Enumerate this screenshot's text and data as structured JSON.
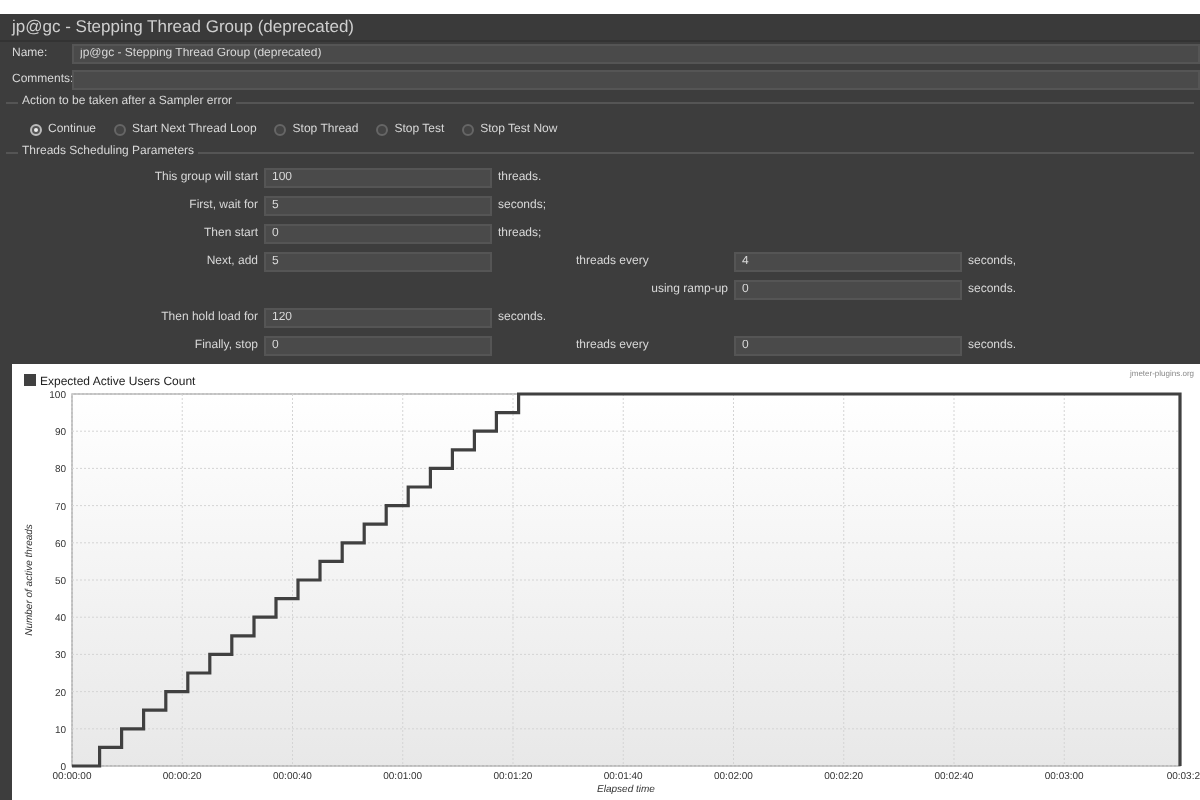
{
  "window": {
    "title": "jp@gc - Stepping Thread Group (deprecated)"
  },
  "name": {
    "label": "Name:",
    "value": "jp@gc - Stepping Thread Group (deprecated)"
  },
  "comments": {
    "label": "Comments:"
  },
  "sampler_error": {
    "title": "Action to be taken after a Sampler error",
    "options": [
      {
        "label": "Continue",
        "selected": true
      },
      {
        "label": "Start Next Thread Loop",
        "selected": false
      },
      {
        "label": "Stop Thread",
        "selected": false
      },
      {
        "label": "Stop Test",
        "selected": false
      },
      {
        "label": "Stop Test Now",
        "selected": false
      }
    ]
  },
  "scheduling": {
    "title": "Threads Scheduling Parameters",
    "rows": [
      {
        "kind": "main",
        "label": "This group will start",
        "value": "100",
        "unit": "threads."
      },
      {
        "kind": "main",
        "label": "First, wait for",
        "value": "5",
        "unit": "seconds;"
      },
      {
        "kind": "main",
        "label": "Then start",
        "value": "0",
        "unit": "threads;"
      },
      {
        "kind": "main",
        "label": "Next, add",
        "value": "5",
        "extra": {
          "label": "threads every",
          "value": "4",
          "unit": "seconds,"
        }
      },
      {
        "kind": "secondary",
        "extra": {
          "label": "using ramp-up",
          "value": "0",
          "unit": "seconds."
        }
      },
      {
        "kind": "main",
        "label": "Then hold load for",
        "value": "120",
        "unit": "seconds."
      },
      {
        "kind": "main",
        "label": "Finally, stop",
        "value": "0",
        "extra": {
          "label": "threads every",
          "value": "0",
          "unit": "seconds."
        }
      }
    ]
  },
  "chart": {
    "credit": "jmeter-plugins.org",
    "chart_data": {
      "type": "line",
      "xlabel": "Elapsed time",
      "ylabel": "Number of active threads",
      "x": [
        0,
        5,
        5,
        9,
        9,
        13,
        13,
        17,
        17,
        21,
        21,
        25,
        25,
        29,
        29,
        33,
        33,
        37,
        37,
        41,
        41,
        45,
        45,
        49,
        49,
        53,
        53,
        57,
        57,
        61,
        61,
        65,
        65,
        69,
        69,
        73,
        73,
        77,
        77,
        81,
        81,
        201,
        201
      ],
      "series": [
        {
          "name": "Expected Active Users Count",
          "color": "#404040",
          "values": [
            0,
            0,
            5,
            5,
            10,
            10,
            15,
            15,
            20,
            20,
            25,
            25,
            30,
            30,
            35,
            35,
            40,
            40,
            45,
            45,
            50,
            50,
            55,
            55,
            60,
            60,
            65,
            65,
            70,
            70,
            75,
            75,
            80,
            80,
            85,
            85,
            90,
            90,
            95,
            95,
            100,
            100,
            0
          ]
        }
      ],
      "xlim": [
        0,
        201
      ],
      "ylim": [
        0,
        100
      ],
      "xticks": [
        {
          "value": 0,
          "label": "00:00:00"
        },
        {
          "value": 20,
          "label": "00:00:20"
        },
        {
          "value": 40,
          "label": "00:00:40"
        },
        {
          "value": 60,
          "label": "00:01:00"
        },
        {
          "value": 80,
          "label": "00:01:20"
        },
        {
          "value": 100,
          "label": "00:01:40"
        },
        {
          "value": 120,
          "label": "00:02:00"
        },
        {
          "value": 140,
          "label": "00:02:20"
        },
        {
          "value": 160,
          "label": "00:02:40"
        },
        {
          "value": 180,
          "label": "00:03:00"
        },
        {
          "value": 201,
          "label": "00:03:2"
        }
      ],
      "yticks": [
        0,
        10,
        20,
        30,
        40,
        50,
        60,
        70,
        80,
        90,
        100
      ],
      "grid": true
    }
  }
}
